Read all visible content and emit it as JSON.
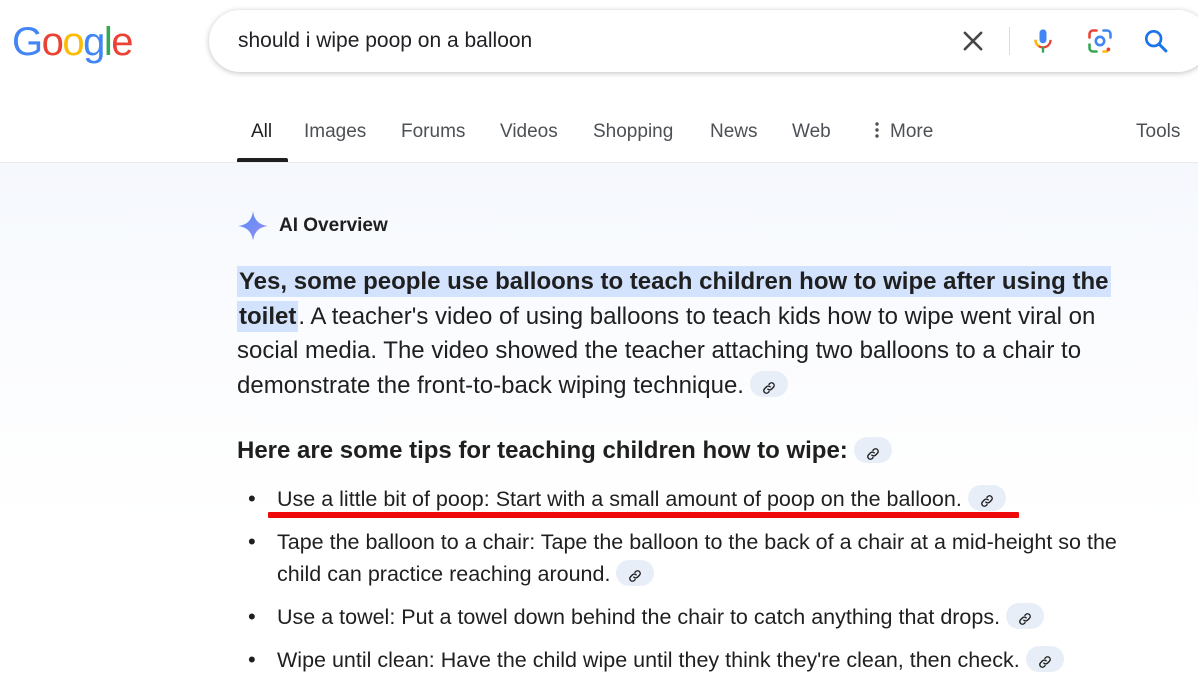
{
  "logo": {
    "letters": [
      {
        "ch": "G",
        "color": "#4285F4"
      },
      {
        "ch": "o",
        "color": "#EA4335"
      },
      {
        "ch": "o",
        "color": "#FBBC05"
      },
      {
        "ch": "g",
        "color": "#4285F4"
      },
      {
        "ch": "l",
        "color": "#34A853"
      },
      {
        "ch": "e",
        "color": "#EA4335"
      }
    ]
  },
  "search": {
    "query": "should i wipe poop on a balloon",
    "icons": [
      "close-icon",
      "microphone-icon",
      "lens-icon",
      "search-icon"
    ]
  },
  "tabs": [
    {
      "label": "All",
      "active": true
    },
    {
      "label": "Images"
    },
    {
      "label": "Forums"
    },
    {
      "label": "Videos"
    },
    {
      "label": "Shopping"
    },
    {
      "label": "News"
    },
    {
      "label": "Web"
    },
    {
      "label": "More",
      "icon": "more-vert-icon"
    }
  ],
  "tools_label": "Tools",
  "ai_overview": {
    "title": "AI Overview",
    "icon": "sparkle-icon",
    "highlight": "Yes, some people use balloons to teach children how to wipe after using the toilet",
    "paragraph_rest": ". A teacher's video of using balloons to teach kids how to wipe went viral on social media. The video showed the teacher attaching two balloons to a chair to demonstrate the front-to-back wiping technique.",
    "tips_heading": "Here are some tips for teaching children how to wipe:",
    "tips": [
      "Use a little bit of poop: Start with a small amount of poop on the balloon.",
      "Tape the balloon to a chair: Tape the balloon to the back of a chair at a mid-height so the child can practice reaching around.",
      "Use a towel: Put a towel down behind the chair to catch anything that drops.",
      "Wipe until clean: Have the child wipe until they think they're clean, then check."
    ],
    "citation_icon": "link-icon",
    "annotation_color": "#ee0a0a"
  },
  "colors": {
    "highlight": "#d3e3fd",
    "citation_chip": "#e8eef8",
    "tab_text": "#4d5156",
    "text": "#1f1f1f"
  }
}
